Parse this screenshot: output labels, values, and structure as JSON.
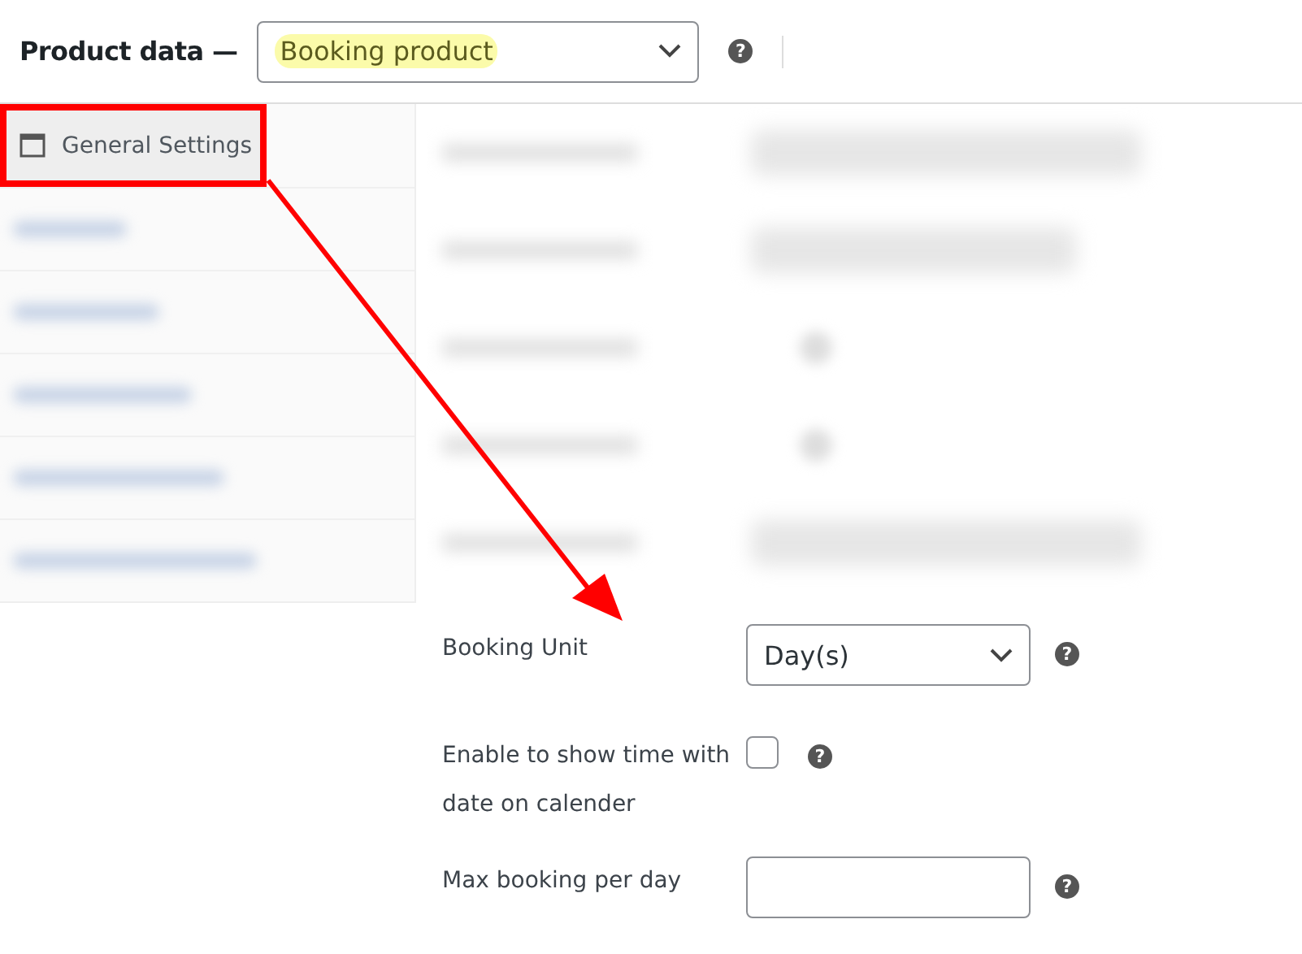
{
  "header": {
    "title": "Product data —",
    "product_type": {
      "value": "Booking product",
      "highlighted": true
    },
    "help": "?"
  },
  "sidebar": {
    "items": [
      {
        "kind": "tab",
        "label": "General Settings",
        "selected": true,
        "annotated": true
      },
      {
        "kind": "blurred",
        "selected": false
      },
      {
        "kind": "blurred",
        "selected": false
      },
      {
        "kind": "blurred",
        "selected": false
      },
      {
        "kind": "blurred",
        "selected": false
      },
      {
        "kind": "blurred",
        "selected": false
      }
    ]
  },
  "fields": [
    {
      "kind": "blurred-wide"
    },
    {
      "kind": "blurred-input"
    },
    {
      "kind": "blurred-check"
    },
    {
      "kind": "blurred-check"
    },
    {
      "kind": "blurred-wide"
    },
    {
      "kind": "select",
      "label": "Booking Unit",
      "value": "Day(s)",
      "help": "?"
    },
    {
      "kind": "checkbox",
      "label": "Enable to show time with date on calender",
      "checked": false,
      "help": "?"
    },
    {
      "kind": "input",
      "label": "Max booking per day",
      "help": "?"
    }
  ]
}
